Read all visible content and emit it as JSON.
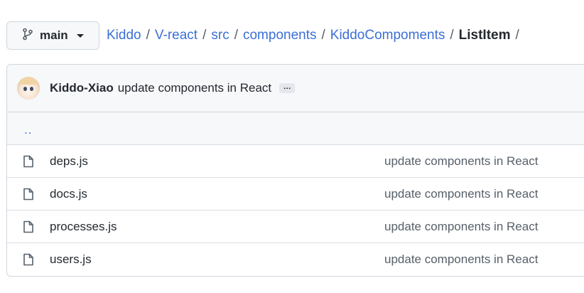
{
  "branch": {
    "icon": "git-branch-icon",
    "name": "main",
    "caret_icon": "triangle-down-icon"
  },
  "breadcrumb": {
    "links": [
      "Kiddo",
      "V-react",
      "src",
      "components",
      "KiddoCompoments"
    ],
    "separator": "/",
    "current": "ListItem",
    "trailing": "/"
  },
  "latest_commit": {
    "avatar": "user-avatar",
    "author": "Kiddo-Xiao",
    "message": "update components in React",
    "more_label": "…"
  },
  "parent_dir": "..",
  "files": [
    {
      "icon": "file-icon",
      "name": "deps.js",
      "commit": "update components in React"
    },
    {
      "icon": "file-icon",
      "name": "docs.js",
      "commit": "update components in React"
    },
    {
      "icon": "file-icon",
      "name": "processes.js",
      "commit": "update components in React"
    },
    {
      "icon": "file-icon",
      "name": "users.js",
      "commit": "update components in React"
    }
  ],
  "colors": {
    "link": "#3b6fd6",
    "text": "#24292f",
    "muted": "#57606a",
    "border": "#d0d7de",
    "header_bg": "#f6f8fa"
  }
}
